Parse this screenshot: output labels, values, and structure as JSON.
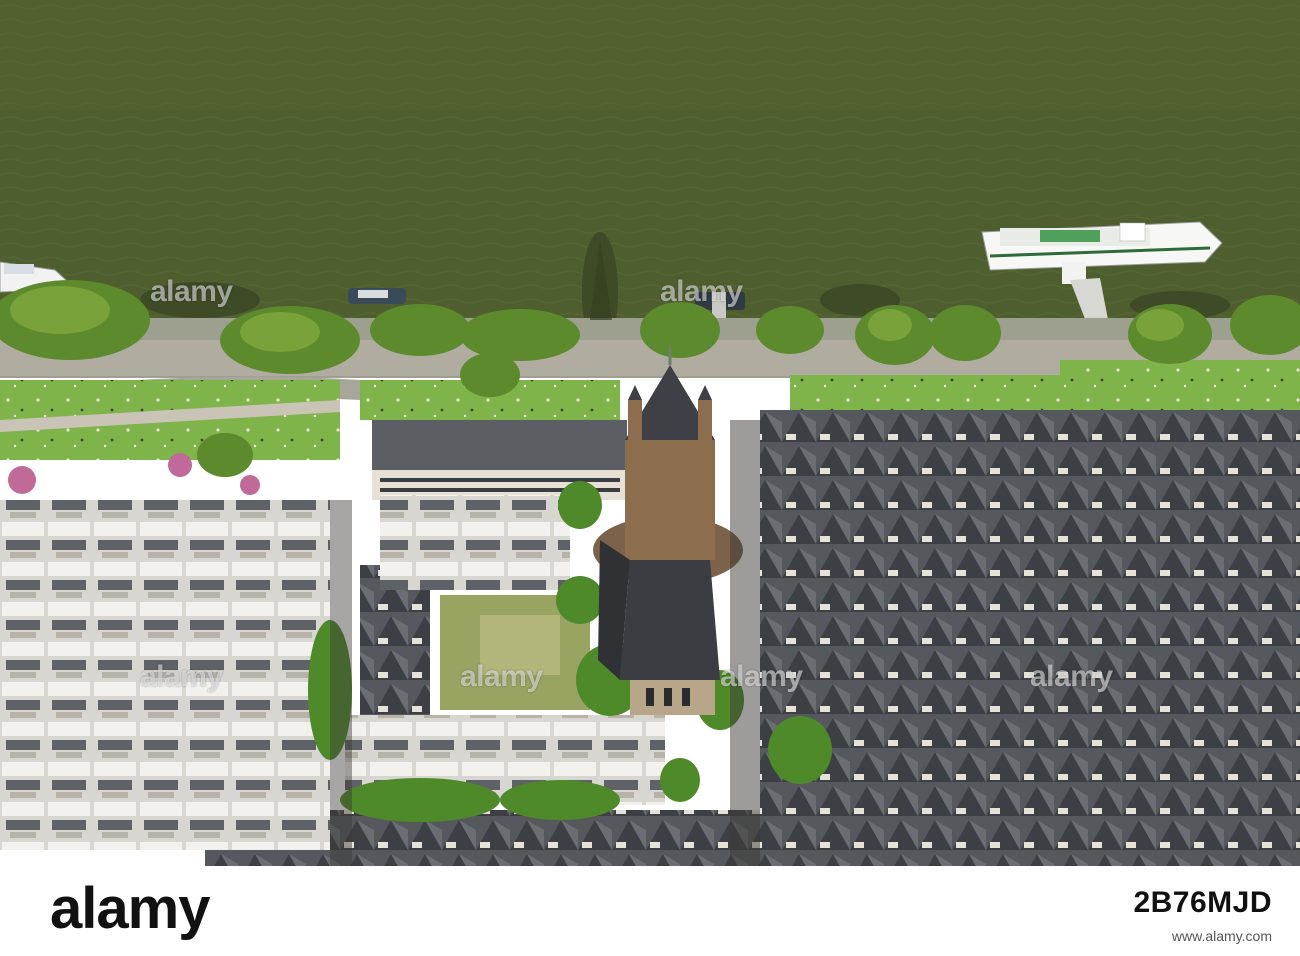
{
  "photo": {
    "alt": "",
    "colors": {
      "river": "#4f5e2f",
      "promenade": "#a9a59a",
      "lawn": "#7fb44a",
      "trees": "#5c8a2c",
      "roofs": "#4a4d52",
      "facade": "#d9d4c8",
      "church": "#8c6e4f"
    }
  },
  "watermarks": [
    "alamy",
    "alamy",
    "alamy",
    "alamy",
    "alamy",
    "alamy"
  ],
  "footer": {
    "logo": "alamy",
    "stock_id": "2B76MJD",
    "url": "www.alamy.com"
  }
}
